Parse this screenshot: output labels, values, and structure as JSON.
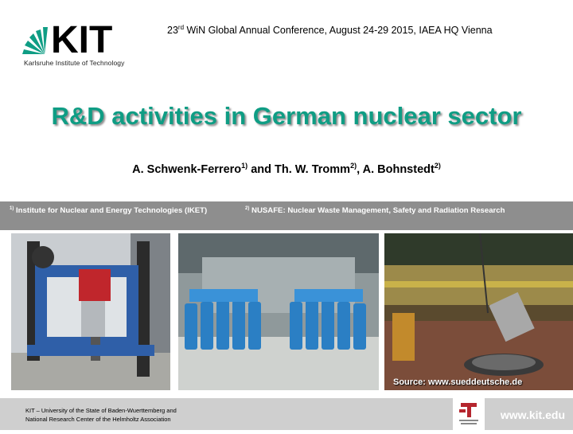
{
  "header": {
    "logo_text": "KIT",
    "logo_subtitle": "Karlsruhe Institute of Technology",
    "conference_number": "23",
    "conference_ordinal": "rd",
    "conference_rest": " WiN Global Annual Conference, August 24-29 2015, IAEA HQ Vienna"
  },
  "title": "R&D activities in German nuclear sector",
  "authors": {
    "a1": "A. Schwenk-Ferrero",
    "a1_sup": "1)",
    "mid": " and Th. W. Tromm",
    "a2_sup": "2)",
    "sep": ", A. Bohnstedt",
    "a3_sup": "2)"
  },
  "affiliations": [
    {
      "sup": "1)",
      "text": " Institute for Nuclear and Energy Technologies (IKET)"
    },
    {
      "sup": "2)",
      "text": " NUSAFE: Nuclear Waste Management, Safety and Radiation Research"
    }
  ],
  "photos": {
    "source_caption": "Source: www.sueddeutsche.de"
  },
  "footer": {
    "line1": "KIT – University of the State of Baden-Wuerttemberg and",
    "line2": "National Research Center of the Helmholtz Association",
    "url": "www.kit.edu"
  },
  "colors": {
    "title_teal": "#0f9d84",
    "band_gray": "#8e8e8e",
    "footer_gray": "#cfcfcf"
  }
}
